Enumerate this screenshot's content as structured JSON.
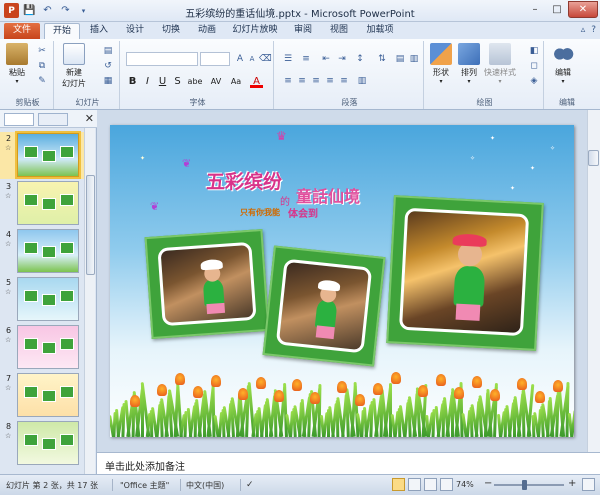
{
  "window": {
    "title": "五彩缤纷的重话仙境.pptx - Microsoft PowerPoint",
    "minimize": "–",
    "maximize": "□",
    "close": "✕"
  },
  "qat": {
    "logo": "P",
    "save": "💾",
    "undo": "↶",
    "redo": "↷"
  },
  "tabs": {
    "file": "文件",
    "items": [
      "开始",
      "插入",
      "设计",
      "切换",
      "动画",
      "幻灯片放映",
      "审阅",
      "视图",
      "加载项"
    ],
    "active": "开始",
    "help": "?"
  },
  "ribbon": {
    "clipboard": {
      "label": "剪贴板",
      "paste": "粘贴"
    },
    "slides": {
      "label": "幻灯片",
      "new_slide": "新建\n幻灯片"
    },
    "font": {
      "label": "字体",
      "bold": "B",
      "italic": "I",
      "underline": "U",
      "strike": "S",
      "shadow": "abe",
      "spacing": "AV",
      "case": "Aa",
      "color": "A"
    },
    "paragraph": {
      "label": "段落"
    },
    "drawing": {
      "label": "绘图",
      "shapes": "形状",
      "arrange": "排列",
      "quick_styles": "快速样式"
    },
    "editing": {
      "label": "编辑",
      "edit": "编辑"
    }
  },
  "left_panel": {
    "close": "✕",
    "slides": [
      {
        "num": "2",
        "selected": true
      },
      {
        "num": "3",
        "selected": false
      },
      {
        "num": "4",
        "selected": false
      },
      {
        "num": "5",
        "selected": false
      },
      {
        "num": "6",
        "selected": false
      },
      {
        "num": "7",
        "selected": false
      },
      {
        "num": "8",
        "selected": false
      }
    ],
    "anim_marker": "☆"
  },
  "slide": {
    "title_main": "五彩缤纷",
    "title_de": "的",
    "title_right": "童話仙境",
    "subtitle": "只有你我能",
    "subtitle2": "体会到"
  },
  "notes": {
    "placeholder": "单击此处添加备注"
  },
  "status": {
    "slide_info": "幻灯片 第 2 张，共 17 张",
    "theme": "\"Office 主题\"",
    "language": "中文(中国)",
    "zoom": "74%",
    "zoom_minus": "−",
    "zoom_plus": "+"
  }
}
